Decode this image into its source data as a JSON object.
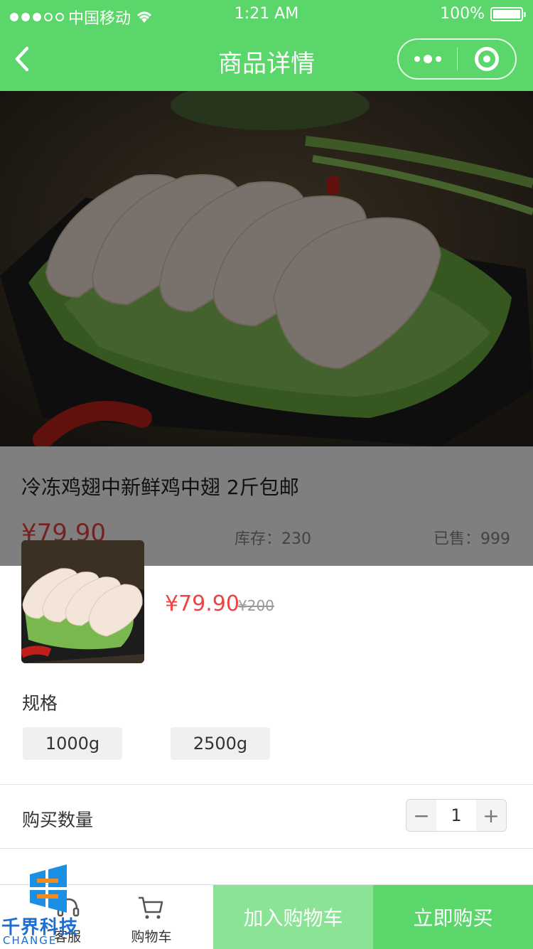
{
  "status_bar": {
    "carrier": "中国移动",
    "time": "1:21 AM",
    "battery": "100%"
  },
  "nav": {
    "title": "商品详情",
    "back_icon": "chevron-left-icon",
    "more_icon": "more-dots-icon",
    "close_icon": "target-circle-icon"
  },
  "product": {
    "name": "冷冻鸡翅中新鲜鸡中翅 2斤包邮",
    "price": "¥79.90",
    "stock": "库存：230",
    "sold": "已售：999"
  },
  "sku_sheet": {
    "price": "¥79.90",
    "original_price": "¥200",
    "spec_label": "规格",
    "spec_options": [
      "1000g",
      "2500g"
    ],
    "quantity_label": "购买数量",
    "quantity": "1",
    "minus": "−",
    "plus": "+"
  },
  "bottom_bar": {
    "service_label": "客服",
    "cart_label": "购物车",
    "add_to_cart": "加入购物车",
    "buy_now": "立即购买"
  },
  "watermark": {
    "brand": "千界科技",
    "sub": "CHANGE"
  },
  "colors": {
    "brand_green": "#5bd66b",
    "light_green": "#8be496",
    "price_red": "#e44444"
  }
}
